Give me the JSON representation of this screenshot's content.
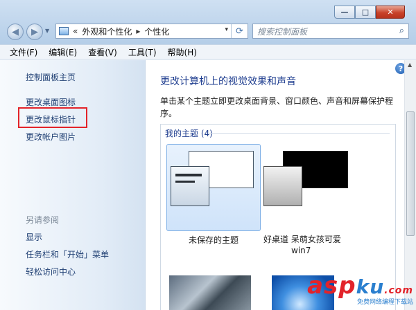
{
  "window": {
    "minimize": "—",
    "maximize": "□",
    "close": "✕"
  },
  "nav": {
    "back_icon": "back-arrow-icon",
    "forward_icon": "forward-arrow-icon"
  },
  "address": {
    "prefix": "«",
    "crumb1": "外观和个性化",
    "separator": "▸",
    "crumb2": "个性化",
    "dropdown": "▾",
    "refresh": "⟳"
  },
  "search": {
    "placeholder": "搜索控制面板",
    "icon": "⌕"
  },
  "menu": [
    "文件(F)",
    "编辑(E)",
    "查看(V)",
    "工具(T)",
    "帮助(H)"
  ],
  "sidebar": {
    "home": "控制面板主页",
    "links": [
      "更改桌面图标",
      "更改鼠标指针",
      "更改帐户图片"
    ],
    "see_also_heading": "另请参阅",
    "see_also": [
      "显示",
      "任务栏和「开始」菜单",
      "轻松访问中心"
    ]
  },
  "main": {
    "help": "?",
    "title": "更改计算机上的视觉效果和声音",
    "description": "单击某个主题立即更改桌面背景、窗口颜色、声音和屏幕保护程序。",
    "group_heading": "我的主题 (4)",
    "themes": [
      {
        "label": "未保存的主题"
      },
      {
        "label_line1": "好桌道 呆萌女孩可爱",
        "label_line2": "win7"
      }
    ]
  },
  "scrollbar": {
    "up": "▲"
  },
  "watermark": {
    "asp": "asp",
    "ku": "ku",
    "com": ".com",
    "sub": "免费网络编程下载站"
  }
}
